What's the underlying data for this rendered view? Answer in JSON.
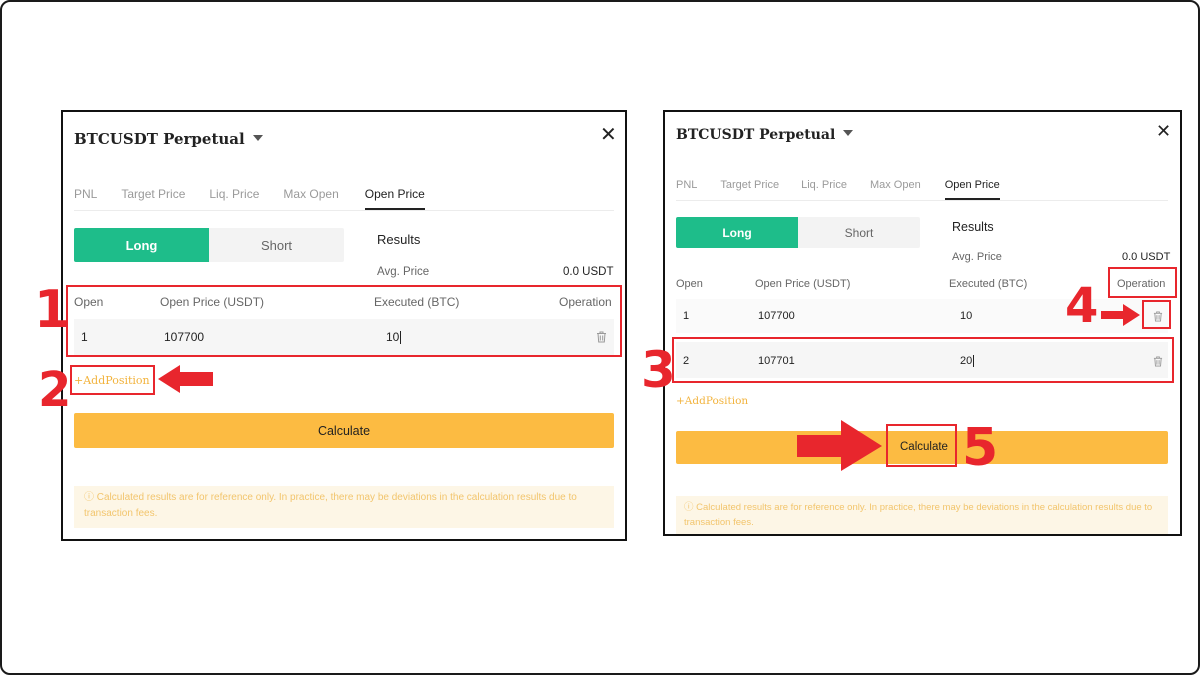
{
  "left": {
    "title": "BTCUSDT Perpetual",
    "tabs": [
      "PNL",
      "Target Price",
      "Liq. Price",
      "Max Open",
      "Open Price"
    ],
    "toggle": {
      "long": "Long",
      "short": "Short"
    },
    "results_label": "Results",
    "avg_price_label": "Avg. Price",
    "avg_price_value": "0.0 USDT",
    "columns": [
      "Open",
      "Open Price (USDT)",
      "Executed (BTC)",
      "Operation"
    ],
    "rows": [
      {
        "open": "1",
        "price": "107700",
        "executed": "10"
      }
    ],
    "add_position": "+AddPosition",
    "calculate": "Calculate",
    "note": "ⓘ Calculated results are for reference only. In practice, there may be deviations in the calculation results due to transaction fees."
  },
  "right": {
    "title": "BTCUSDT Perpetual",
    "tabs": [
      "PNL",
      "Target Price",
      "Liq. Price",
      "Max Open",
      "Open Price"
    ],
    "toggle": {
      "long": "Long",
      "short": "Short"
    },
    "results_label": "Results",
    "avg_price_label": "Avg. Price",
    "avg_price_value": "0.0 USDT",
    "columns": [
      "Open",
      "Open Price (USDT)",
      "Executed (BTC)",
      "Operation"
    ],
    "rows": [
      {
        "open": "1",
        "price": "107700",
        "executed": "10"
      },
      {
        "open": "2",
        "price": "107701",
        "executed": "20"
      }
    ],
    "add_position": "+AddPosition",
    "calculate": "Calculate",
    "note": "ⓘ Calculated results are for reference only. In practice, there may be deviations in the calculation results due to transaction fees."
  },
  "annotations": {
    "step1": "1",
    "step2": "2",
    "step3": "3",
    "step4": "4",
    "step5": "5"
  },
  "colors": {
    "accent_green": "#1ebd8a",
    "button_yellow": "#fcbb42",
    "annotation_red": "#e8262d",
    "link_orange": "#f2b33d"
  },
  "icons": {
    "close": "close-icon",
    "dropdown": "chevron-down-icon",
    "delete": "trash-icon",
    "arrow": "arrow-right-icon"
  }
}
